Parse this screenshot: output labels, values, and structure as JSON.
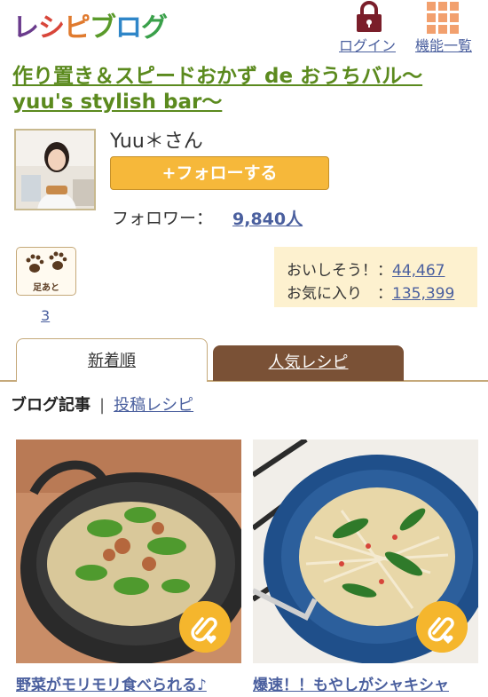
{
  "header": {
    "logo_chars": [
      {
        "ch": "レ",
        "color": "#6a3b8c"
      },
      {
        "ch": "シ",
        "color": "#d8463a"
      },
      {
        "ch": "ピ",
        "color": "#e07a2e"
      },
      {
        "ch": "ブ",
        "color": "#5a9a2a"
      },
      {
        "ch": "ロ",
        "color": "#2f86c8"
      },
      {
        "ch": "グ",
        "color": "#3aa04a"
      }
    ],
    "login_label": "ログイン",
    "features_label": "機能一覧"
  },
  "blog": {
    "title": "作り置き＆スピードおかず de おうちバル〜yuu's stylish bar〜"
  },
  "profile": {
    "name": "Yuu＊さん",
    "follow_label": "+フォローする",
    "follower_label": "フォロワー：",
    "follower_count": "9,840人"
  },
  "footprint": {
    "label": "足あと",
    "count": "3"
  },
  "stats": {
    "oishisou_label": "おいしそう！：",
    "oishisou_value": "44,467",
    "favorite_label": "お気に入り　：",
    "favorite_value": "135,399"
  },
  "tabs": {
    "new_label": "新着順",
    "popular_label": "人気レシピ"
  },
  "subnav": {
    "blog_label": "ブログ記事",
    "separator": "|",
    "recipe_label": "投稿レシピ"
  },
  "recipes": [
    {
      "caption": "野菜がモリモリ食べられる♪"
    },
    {
      "caption": "爆速！！もやしがシャキシャ"
    }
  ],
  "colors": {
    "accent_green": "#5b8a1e",
    "link_blue": "#4a5f9e",
    "follow_orange": "#f6b83a",
    "tab_brown": "#7a5136"
  }
}
